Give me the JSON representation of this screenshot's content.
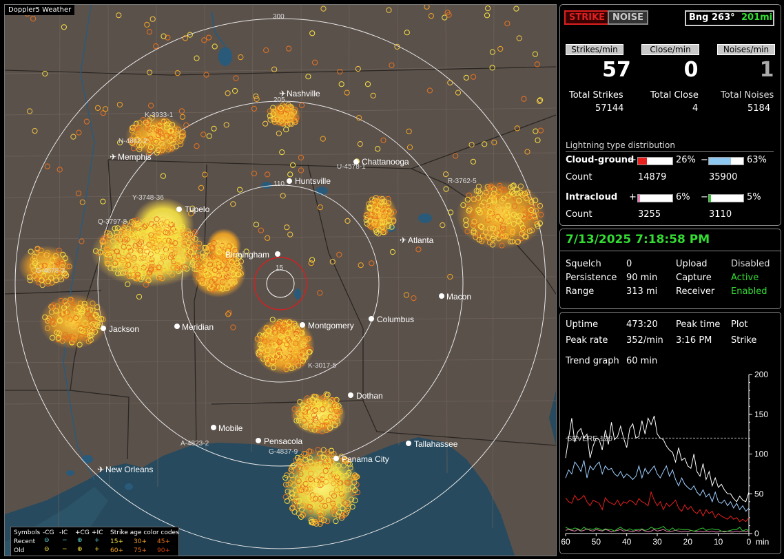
{
  "app_title": "Doppler5 Weather",
  "status": {
    "strike": "STRIKE",
    "noise": "NOISE",
    "bearing": "Bng 263°",
    "range": "201mi"
  },
  "rates": {
    "strikes_label": "Strikes/min",
    "close_label": "Close/min",
    "noises_label": "Noises/min",
    "strikes": "57",
    "close": "0",
    "noises": "1",
    "total_strikes_label": "Total Strikes",
    "total_close_label": "Total Close",
    "total_noises_label": "Total Noises",
    "total_strikes": "57144",
    "total_close": "4",
    "total_noises": "5184"
  },
  "distribution": {
    "title": "Lightning type distribution",
    "cg_label": "Cloud-ground",
    "plus": "+",
    "minus": "−",
    "cg_pos_pct": "26%",
    "cg_neg_pct": "63%",
    "count_label": "Count",
    "cg_pos_count": "14879",
    "cg_neg_count": "35900",
    "ic_label": "Intracloud",
    "ic_pos_pct": "6%",
    "ic_neg_pct": "5%",
    "ic_pos_count": "3255",
    "ic_neg_count": "3110",
    "fills": {
      "cg_pos": 0.26,
      "cg_neg": 0.63,
      "ic_pos": 0.06,
      "ic_neg": 0.05
    },
    "colors": {
      "cg_pos": "#e8201e",
      "cg_neg": "#8fc8f0",
      "ic_pos": "#e87fb0",
      "ic_neg": "#22cc22"
    }
  },
  "system": {
    "datetime": "7/13/2025 7:18:58 PM",
    "squelch_label": "Squelch",
    "squelch": "0",
    "persistence_label": "Persistence",
    "persistence": "90 min",
    "range_label": "Range",
    "range": "313 mi",
    "upload_label": "Upload",
    "upload": "Disabled",
    "capture_label": "Capture",
    "capture": "Active",
    "receiver_label": "Receiver",
    "receiver": "Enabled"
  },
  "trend": {
    "uptime_label": "Uptime",
    "uptime": "473:20",
    "peak_time_label": "Peak time",
    "peak_time": "3:16 PM",
    "plot_label": "Plot",
    "plot": "Strike",
    "peak_rate_label": "Peak rate",
    "peak_rate": "352/min",
    "trend_graph_label": "Trend graph",
    "trend_graph": "60 min"
  },
  "chart_data": {
    "type": "line",
    "x": [
      60,
      59,
      58,
      57,
      56,
      55,
      54,
      53,
      52,
      51,
      50,
      49,
      48,
      47,
      46,
      45,
      44,
      43,
      42,
      41,
      40,
      39,
      38,
      37,
      36,
      35,
      34,
      33,
      32,
      31,
      30,
      29,
      28,
      27,
      26,
      25,
      24,
      23,
      22,
      21,
      20,
      19,
      18,
      17,
      16,
      15,
      14,
      13,
      12,
      11,
      10,
      9,
      8,
      7,
      6,
      5,
      4,
      3,
      2,
      1,
      0
    ],
    "series": [
      {
        "color": "#ffffff",
        "values": [
          95,
          120,
          145,
          115,
          128,
          132,
          120,
          125,
          95,
          110,
          120,
          118,
          105,
          130,
          112,
          140,
          118,
          122,
          135,
          120,
          108,
          132,
          138,
          120,
          122,
          142,
          125,
          145,
          137,
          148,
          125,
          120,
          118,
          110,
          105,
          102,
          90,
          108,
          92,
          95,
          85,
          82,
          100,
          78,
          72,
          88,
          68,
          78,
          60,
          70,
          58,
          62,
          55,
          50,
          50,
          44,
          40,
          47,
          42,
          40,
          52
        ],
        "stroke_width": 1
      },
      {
        "color": "#9fcfff",
        "values": [
          70,
          80,
          75,
          90,
          85,
          78,
          92,
          70,
          85,
          80,
          86,
          90,
          75,
          85,
          80,
          82,
          75,
          72,
          78,
          70,
          75,
          72,
          68,
          72,
          85,
          70,
          82,
          75,
          80,
          85,
          75,
          70,
          78,
          85,
          72,
          80,
          68,
          60,
          70,
          62,
          58,
          55,
          60,
          52,
          48,
          55,
          46,
          50,
          40,
          52,
          40,
          38,
          42,
          35,
          40,
          32,
          38,
          30,
          35,
          28,
          32
        ],
        "stroke_width": 1
      },
      {
        "color": "#e8201e",
        "values": [
          45,
          40,
          38,
          48,
          42,
          44,
          48,
          40,
          35,
          42,
          40,
          38,
          30,
          45,
          40,
          38,
          36,
          42,
          35,
          40,
          38,
          42,
          40,
          36,
          44,
          40,
          38,
          35,
          52,
          42,
          35,
          40,
          30,
          38,
          34,
          38,
          42,
          32,
          28,
          36,
          30,
          34,
          28,
          25,
          30,
          22,
          30,
          25,
          28,
          20,
          25,
          22,
          20,
          18,
          22,
          18,
          20,
          15,
          18,
          15,
          20
        ],
        "stroke_width": 1
      },
      {
        "color": "#33cc33",
        "values": [
          8,
          6,
          5,
          7,
          6,
          4,
          8,
          5,
          6,
          5,
          7,
          6,
          4,
          6,
          5,
          5,
          3,
          6,
          8,
          5,
          4,
          6,
          4,
          5,
          5,
          6,
          4,
          5,
          8,
          6,
          6,
          7,
          9,
          5,
          4,
          7,
          4,
          6,
          5,
          5,
          5,
          4,
          3,
          4,
          6,
          7,
          4,
          5,
          6,
          5,
          5,
          3,
          3,
          3,
          4,
          5,
          5,
          8,
          3,
          5,
          4
        ]
      },
      {
        "color": "#e87fb0",
        "values": [
          4,
          5,
          4,
          3,
          5,
          3,
          4,
          6,
          4,
          3,
          5,
          4,
          3,
          5,
          4,
          2,
          3,
          4,
          5,
          3,
          4,
          3,
          2,
          4,
          3,
          5,
          3,
          2,
          3,
          5,
          3,
          4,
          5,
          3,
          2,
          3,
          4,
          3,
          2,
          3,
          2,
          4,
          3,
          2,
          3,
          2,
          3,
          2,
          3,
          2,
          2,
          3,
          2,
          3,
          2,
          2,
          3,
          2,
          3,
          2,
          4
        ]
      }
    ],
    "ylim": [
      0,
      200
    ],
    "y_ticks": [
      "200",
      "150",
      "100",
      "50",
      "0"
    ],
    "x_ticks": [
      "60",
      "50",
      "40",
      "30",
      "20",
      "10",
      "0"
    ],
    "xlabel": "min",
    "severe_label": "SEVERE 120",
    "severe_value": 120
  },
  "map": {
    "range_rings": [
      "300",
      "205",
      "110",
      "15"
    ],
    "cities": [
      "Nashville",
      "Chattanooga",
      "Huntsville",
      "Memphis",
      "Tupelo",
      "Birmingham",
      "Atlanta",
      "Macon",
      "Jackson",
      "Meridian",
      "Montgomery",
      "Columbus",
      "Dothan",
      "Mobile",
      "Pensacola",
      "Tallahassee",
      "Panama City",
      "New Orleans"
    ],
    "storm_ids": [
      "K-3933-1",
      "N-4842-2",
      "U-4578-1",
      "R-3762-5",
      "Q-3797-8",
      "Y-3748-36",
      "G-4678-3",
      "K-3017-5",
      "A-4823-2",
      "G-4837-9"
    ]
  },
  "legend": {
    "symbols": "Symbols",
    "neg_cg": "-CG",
    "neg_ic": "-IC",
    "pos_cg": "+CG",
    "pos_ic": "+IC",
    "age_codes": "Strike age color codes",
    "recent": "Recent",
    "old": "Old",
    "age_recent": [
      "15+",
      "30+",
      "45+"
    ],
    "age_old": [
      "60+",
      "75+",
      "90+"
    ]
  }
}
